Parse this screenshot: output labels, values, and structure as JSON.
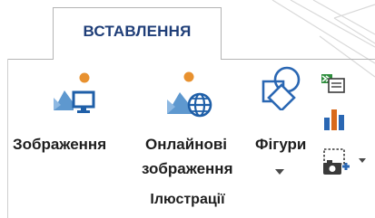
{
  "tab": {
    "label": "ВСТАВЛЕННЯ"
  },
  "group": {
    "label": "Ілюстрації",
    "buttons": [
      {
        "id": "pictures",
        "line1": "Зображення",
        "line2": "",
        "icon": "picture-monitor-icon"
      },
      {
        "id": "online-pictures",
        "line1": "Онлайнові",
        "line2": "зображення",
        "icon": "picture-globe-icon"
      },
      {
        "id": "shapes",
        "line1": "Фігури",
        "line2": "",
        "icon": "shapes-icon",
        "dropdown": true
      }
    ],
    "small_buttons": [
      {
        "id": "smartart",
        "icon": "smartart-icon"
      },
      {
        "id": "chart",
        "icon": "chart-icon"
      },
      {
        "id": "screenshot",
        "icon": "screenshot-icon",
        "dropdown": true
      }
    ]
  },
  "colors": {
    "tab_text": "#1f3e78",
    "picture_sky": "#5e98cf",
    "picture_sun": "#e8912f",
    "device_blue": "#1f5fa8",
    "smartart_green": "#2f8f3e",
    "chart_orange": "#d96a1c",
    "chart_blue": "#2a67b3"
  }
}
